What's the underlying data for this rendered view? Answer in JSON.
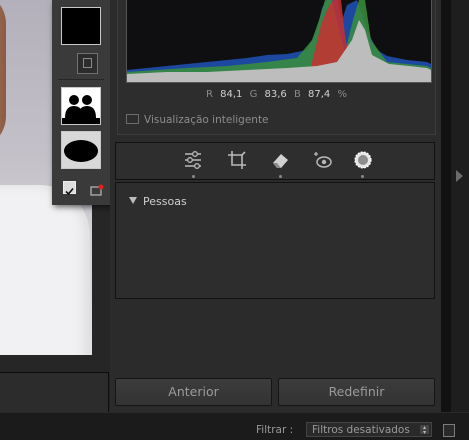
{
  "histogram": {
    "r_label": "R",
    "r_value": "84,1",
    "g_label": "G",
    "g_value": "83,6",
    "b_label": "B",
    "b_value": "87,4",
    "unit": "%"
  },
  "smart_preview": {
    "label": "Visualização inteligente"
  },
  "tools": [
    {
      "name": "edit-sliders-icon"
    },
    {
      "name": "crop-icon"
    },
    {
      "name": "eraser-icon"
    },
    {
      "name": "red-eye-icon"
    },
    {
      "name": "masking-icon"
    }
  ],
  "masks_panel": {
    "group_label": "Pessoas"
  },
  "buttons": {
    "previous": "Anterior",
    "reset": "Redefinir"
  },
  "filter": {
    "label": "Filtrar :",
    "value": "Filtros desativados"
  },
  "colors": {
    "panel": "#2b2b2b",
    "background": "#1b1b1b",
    "accent_text": "#d0d0d0"
  }
}
